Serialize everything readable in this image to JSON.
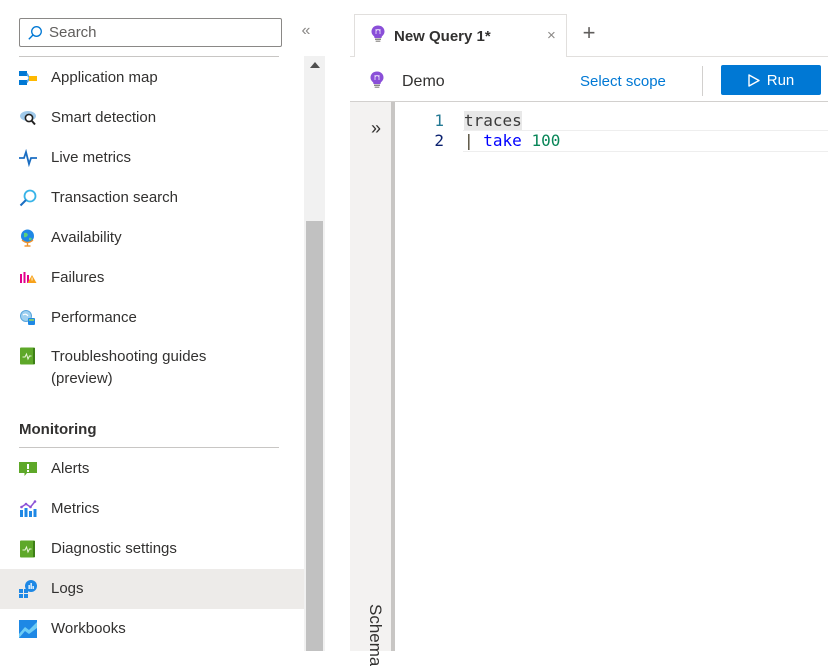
{
  "sidebar": {
    "search": {
      "placeholder": "Search",
      "value": ""
    },
    "collapse_label": "«",
    "items": [
      {
        "label": "Application map",
        "icon": "application-map-icon"
      },
      {
        "label": "Smart detection",
        "icon": "smart-detection-icon"
      },
      {
        "label": "Live metrics",
        "icon": "live-metrics-icon"
      },
      {
        "label": "Transaction search",
        "icon": "transaction-search-icon"
      },
      {
        "label": "Availability",
        "icon": "availability-icon"
      },
      {
        "label": "Failures",
        "icon": "failures-icon"
      },
      {
        "label": "Performance",
        "icon": "performance-icon"
      },
      {
        "label": "Troubleshooting guides (preview)",
        "icon": "troubleshooting-guides-icon"
      }
    ],
    "sections": [
      {
        "title": "Monitoring",
        "items": [
          {
            "label": "Alerts",
            "icon": "alerts-icon"
          },
          {
            "label": "Metrics",
            "icon": "metrics-icon"
          },
          {
            "label": "Diagnostic settings",
            "icon": "diagnostic-settings-icon"
          },
          {
            "label": "Logs",
            "icon": "logs-icon",
            "selected": true
          },
          {
            "label": "Workbooks",
            "icon": "workbooks-icon"
          }
        ]
      }
    ]
  },
  "tabs": [
    {
      "label": "New Query 1*",
      "active": true,
      "close_label": "×",
      "icon": "query-bulb-icon"
    }
  ],
  "new_tab_label": "+",
  "toolbar": {
    "scope_name": "Demo",
    "select_scope_label": "Select scope",
    "run_label": "Run"
  },
  "schema_pane": {
    "expand_label": "»",
    "title": "Schema"
  },
  "editor": {
    "lines": [
      {
        "number": "1",
        "tokens": [
          {
            "text": "traces",
            "type": "table"
          }
        ]
      },
      {
        "number": "2",
        "tokens": [
          {
            "text": "| ",
            "type": "pipe"
          },
          {
            "text": "take",
            "type": "keyword"
          },
          {
            "text": " ",
            "type": "plain"
          },
          {
            "text": "100",
            "type": "number"
          }
        ]
      }
    ]
  },
  "colors": {
    "accent": "#0078d4",
    "selected_item_bg": "#edebe9",
    "keyword": "#0000ff",
    "number": "#098658",
    "line_number": "#237893",
    "bulb_purple": "#8a4fd8"
  }
}
